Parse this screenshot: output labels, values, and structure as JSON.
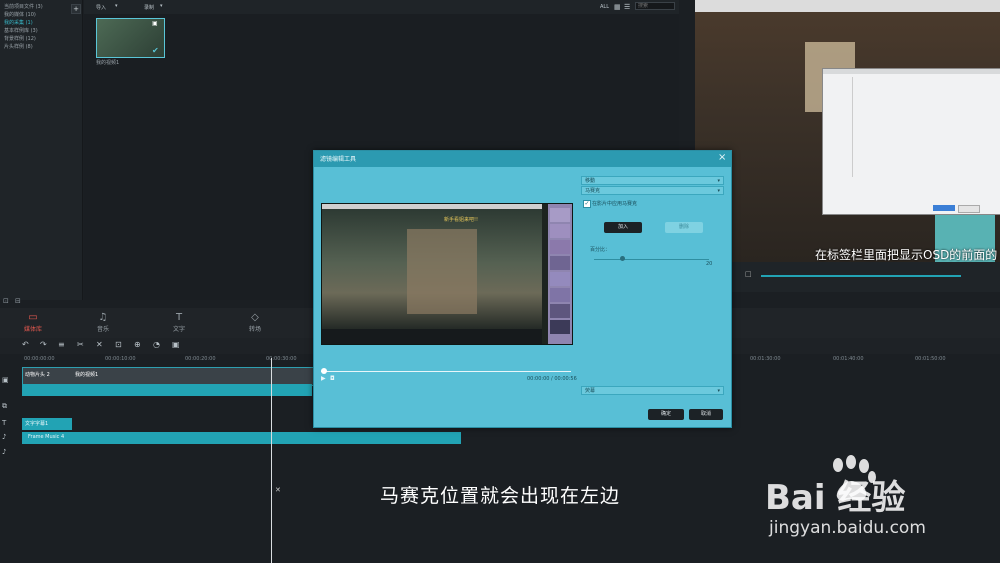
{
  "library": {
    "folders": [
      "当前项目文件 (3)",
      "我的媒体 (10)",
      "我的采集 (1)",
      "基本样例库 (3)",
      "背景样例 (12)",
      "片头样例 (8)"
    ],
    "active_index": 2
  },
  "media": {
    "import_label": "导入",
    "record_label": "录制",
    "filter_label": "ALL",
    "search_placeholder": "搜索",
    "thumb_caption": "我的视频1"
  },
  "preview": {
    "subtitle": "在标签栏里面把显示OSD的前面的"
  },
  "tabs": [
    {
      "label": "媒体库",
      "icon": "folder-icon"
    },
    {
      "label": "音乐",
      "icon": "music-icon"
    },
    {
      "label": "文字",
      "icon": "text-icon"
    },
    {
      "label": "转场",
      "icon": "transition-icon"
    }
  ],
  "timeline": {
    "ruler": [
      "00:00:00:00",
      "00:00:10:00",
      "00:00:20:00",
      "00:00:30:00",
      "00:01:30:00",
      "00:01:40:00",
      "00:01:50:00"
    ],
    "clip_video": "动物片头 2",
    "clip_video2": "我的视频1",
    "clip_text": "文字字幕1",
    "clip_music": "Frame Music 4"
  },
  "dialog": {
    "title": "滤镜编辑工具",
    "dropdown1": "移動",
    "dropdown2": "马赛克",
    "checkbox_label": "在影片中应用马赛克",
    "add_button": "加入",
    "delete_button": "删除",
    "percent_label": "百分比：",
    "percent_value": "20",
    "time_display": "00:00:00 / 00:00:56",
    "dropdown3": "荧幕",
    "ok_button": "确定",
    "cancel_button": "取消",
    "video_overlay_text": "新手看姐来吧!!"
  },
  "caption": "马赛克位置就会出现在左边",
  "watermark": {
    "brand_text": "Bai 经验",
    "url": "jingyan.baidu.com"
  },
  "colors": {
    "accent": "#2c9ab1",
    "dialog_bg": "#58bfd6",
    "active_tab": "#e2584f"
  }
}
